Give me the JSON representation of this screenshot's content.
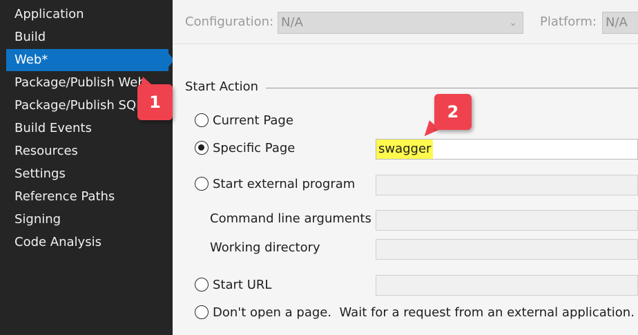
{
  "sidebar": {
    "items": [
      {
        "label": "Application"
      },
      {
        "label": "Build"
      },
      {
        "label": "Web*",
        "selected": true
      },
      {
        "label": "Package/Publish Web"
      },
      {
        "label": "Package/Publish SQL"
      },
      {
        "label": "Build Events"
      },
      {
        "label": "Resources"
      },
      {
        "label": "Settings"
      },
      {
        "label": "Reference Paths"
      },
      {
        "label": "Signing"
      },
      {
        "label": "Code Analysis"
      }
    ]
  },
  "toolbar": {
    "configuration_label": "Configuration:",
    "configuration_value": "N/A",
    "platform_label": "Platform:",
    "platform_value": "N/A"
  },
  "start_action": {
    "title": "Start Action",
    "current_page_label": "Current Page",
    "specific_page_label": "Specific Page",
    "specific_page_value": "swagger",
    "external_program_label": "Start external program",
    "external_program_value": "",
    "command_line_label": "Command line arguments",
    "command_line_value": "",
    "working_dir_label": "Working directory",
    "working_dir_value": "",
    "start_url_label": "Start URL",
    "start_url_value": "",
    "dont_open_label": "Don't open a page.  Wait for a request from an external application.",
    "selected": "specific_page"
  },
  "callouts": {
    "one": "1",
    "two": "2"
  },
  "colors": {
    "sidebar_bg": "#252526",
    "selected_bg": "#0e72c4",
    "callout": "#f0424e",
    "highlight": "#fff94d"
  }
}
